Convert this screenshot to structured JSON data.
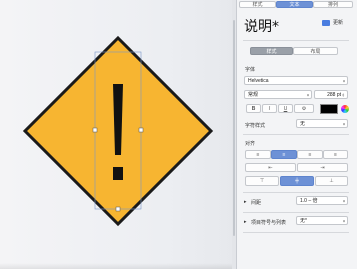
{
  "tabs": [
    {
      "label": "样式"
    },
    {
      "label": "文本"
    },
    {
      "label": "排列"
    }
  ],
  "style_name": "说明*",
  "update_label": "更新",
  "text_type_tabs": [
    {
      "label": "样式"
    },
    {
      "label": "布局"
    }
  ],
  "font_section_label": "字体",
  "font_name": "Helvetica",
  "font_weight": "常规",
  "font_size": "288 pt",
  "style_buttons": [
    "B",
    "I",
    "U",
    "⚙"
  ],
  "text_color": "#000000",
  "char_style_label": "字符样式",
  "char_style_value": "无",
  "alignment_label": "对齐",
  "spacing_label": "间距",
  "spacing_value": "1.0 – 倍",
  "bullets_label": "项目符号与列表",
  "bullets_value": "无*",
  "colors": {
    "sign_fill": "#f7b531",
    "sign_stroke": "#1a1a1a",
    "accent": "#6d91d6"
  }
}
